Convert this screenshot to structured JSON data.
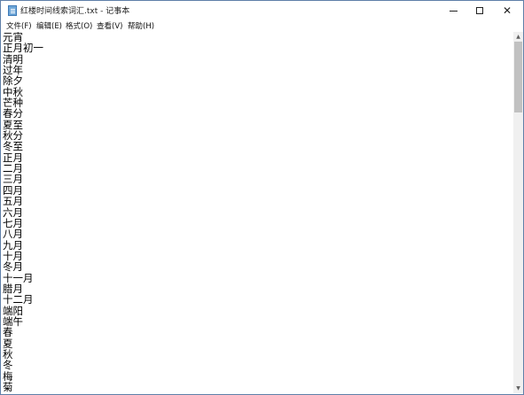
{
  "window": {
    "title": "红楼时间线索词汇.txt - 记事本",
    "min_label": "",
    "max_label": "",
    "close_label": "✕"
  },
  "menu": {
    "file": "文件(F)",
    "edit": "编辑(E)",
    "format": "格式(O)",
    "view": "查看(V)",
    "help": "帮助(H)"
  },
  "editor": {
    "lines": [
      "元宵",
      "正月初一",
      "清明",
      "过年",
      "除夕",
      "中秋",
      "芒种",
      "春分",
      "夏至",
      "秋分",
      "冬至",
      "正月",
      "二月",
      "三月",
      "四月",
      "五月",
      "六月",
      "七月",
      "八月",
      "九月",
      "十月",
      "冬月",
      "十一月",
      "腊月",
      "十二月",
      "端阳",
      "端午",
      "春",
      "夏",
      "秋",
      "冬",
      "梅",
      "菊"
    ]
  },
  "scrollbar": {
    "up_icon": "▲",
    "down_icon": "▼"
  },
  "icons": {
    "app": "notepad-icon",
    "minimize": "minimize-icon",
    "maximize": "maximize-icon",
    "close": "close-icon"
  }
}
